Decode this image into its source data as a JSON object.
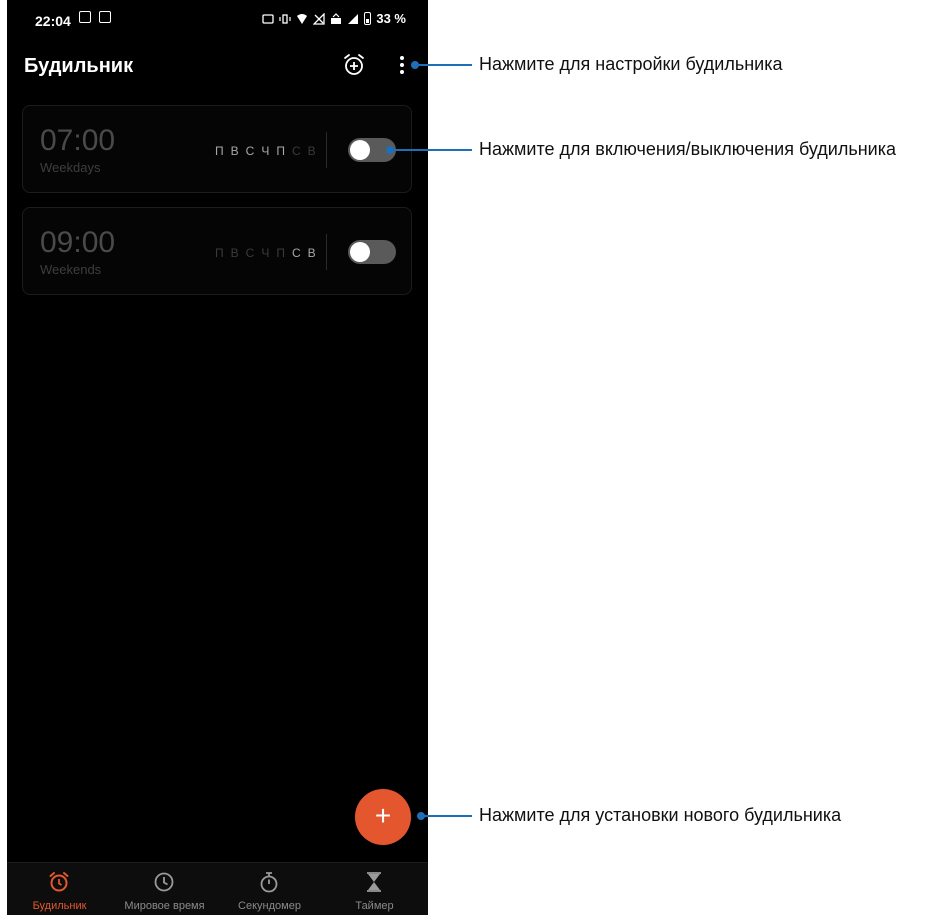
{
  "status_bar": {
    "time": "22:04",
    "battery": "33 %"
  },
  "header": {
    "title": "Будильник"
  },
  "alarms": [
    {
      "time": "07:00",
      "label": "Weekdays",
      "days": [
        {
          "letter": "П",
          "on": true
        },
        {
          "letter": "В",
          "on": true
        },
        {
          "letter": "С",
          "on": true
        },
        {
          "letter": "Ч",
          "on": true
        },
        {
          "letter": "П",
          "on": true
        },
        {
          "letter": "С",
          "on": false
        },
        {
          "letter": "В",
          "on": false
        }
      ],
      "enabled": false
    },
    {
      "time": "09:00",
      "label": "Weekends",
      "days": [
        {
          "letter": "П",
          "on": false
        },
        {
          "letter": "В",
          "on": false
        },
        {
          "letter": "С",
          "on": false
        },
        {
          "letter": "Ч",
          "on": false
        },
        {
          "letter": "П",
          "on": false
        },
        {
          "letter": "С",
          "on": true
        },
        {
          "letter": "В",
          "on": true
        }
      ],
      "enabled": false
    }
  ],
  "fab": {
    "label": "+"
  },
  "bottom_nav": [
    {
      "label": "Будильник",
      "icon": "alarm-icon",
      "active": true
    },
    {
      "label": "Мировое время",
      "icon": "clock-icon",
      "active": false
    },
    {
      "label": "Секундомер",
      "icon": "stopwatch-icon",
      "active": false
    },
    {
      "label": "Таймер",
      "icon": "hourglass-icon",
      "active": false
    }
  ],
  "annotations": {
    "settings": "Нажмите для настройки будильника",
    "toggle": "Нажмите для включения/выключения будильника",
    "new_alarm": "Нажмите для установки нового будильника"
  },
  "colors": {
    "accent": "#e4572e",
    "callout": "#1f6fb8",
    "background": "#000000"
  }
}
